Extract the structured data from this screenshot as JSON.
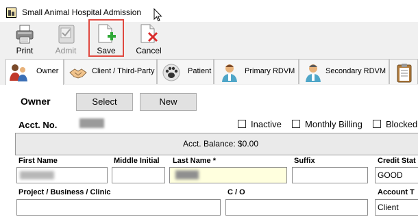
{
  "window": {
    "title": "Small Animal Hospital Admission"
  },
  "toolbar": {
    "print_label": "Print",
    "admit_label": "Admit",
    "save_label": "Save",
    "cancel_label": "Cancel",
    "highlight_color": "#e0483f"
  },
  "tabs": [
    {
      "label": "Owner",
      "icon": "people-icon",
      "active": true
    },
    {
      "label": "Client / Third-Party",
      "icon": "handshake-icon"
    },
    {
      "label": "Patient",
      "icon": "paw-icon"
    },
    {
      "label": "Primary RDVM",
      "icon": "doctor-icon"
    },
    {
      "label": "Secondary RDVM",
      "icon": "doctor-icon"
    },
    {
      "label": "",
      "icon": "clipboard-icon"
    }
  ],
  "owner": {
    "section_title": "Owner",
    "select_label": "Select",
    "new_label": "New",
    "acct_no_label": "Acct. No.",
    "inactive_label": "Inactive",
    "monthly_billing_label": "Monthly Billing",
    "blocked_label": "Blocked"
  },
  "balance": {
    "text": "Acct. Balance: $0.00"
  },
  "fields": {
    "first_name_label": "First Name",
    "middle_initial_label": "Middle Initial",
    "last_name_label": "Last Name *",
    "suffix_label": "Suffix",
    "credit_status_label": "Credit Stat",
    "credit_status_value": "GOOD",
    "project_label": "Project / Business / Clinic",
    "co_label": "C / O",
    "account_type_label": "Account T",
    "account_type_value": "Client"
  }
}
